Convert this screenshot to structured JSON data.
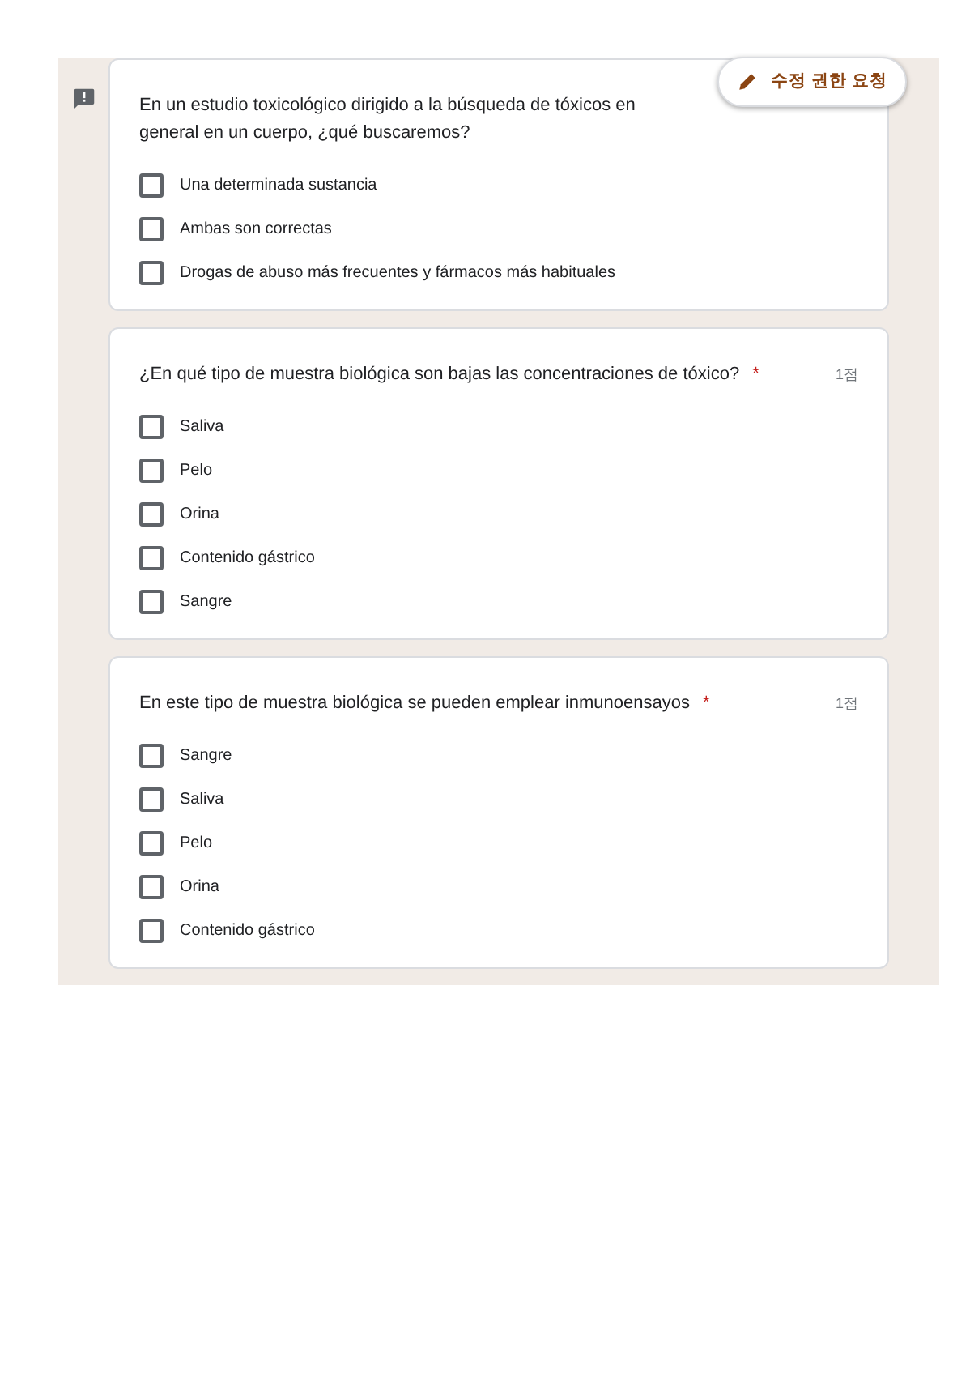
{
  "edit_request_button": {
    "label": "수정 권한 요청"
  },
  "questions": [
    {
      "text": "En un estudio toxicológico dirigido a la búsqueda de tóxicos en general en un cuerpo, ¿qué buscaremos?",
      "flagged": true,
      "options": [
        {
          "label": "Una determinada sustancia",
          "checked": false
        },
        {
          "label": "Ambas son correctas",
          "checked": false
        },
        {
          "label": "Drogas de abuso más frecuentes y fármacos más habituales",
          "checked": false
        }
      ]
    },
    {
      "text": "¿En qué tipo de muestra biológica son bajas las concentraciones de tóxico?",
      "required_mark": "*",
      "flagged": false,
      "points": "1점",
      "options": [
        {
          "label": "Saliva",
          "checked": false
        },
        {
          "label": "Pelo",
          "checked": false
        },
        {
          "label": "Orina",
          "checked": false
        },
        {
          "label": "Contenido gástrico",
          "checked": false
        },
        {
          "label": "Sangre",
          "checked": false
        }
      ]
    },
    {
      "text": "En este tipo de muestra biológica se pueden emplear inmunoensayos",
      "required_mark": "*",
      "flagged": false,
      "points": "1점",
      "options": [
        {
          "label": "Sangre",
          "checked": false
        },
        {
          "label": "Saliva",
          "checked": false
        },
        {
          "label": "Pelo",
          "checked": false
        },
        {
          "label": "Orina",
          "checked": false
        },
        {
          "label": "Contenido gástrico",
          "checked": false
        }
      ]
    }
  ]
}
